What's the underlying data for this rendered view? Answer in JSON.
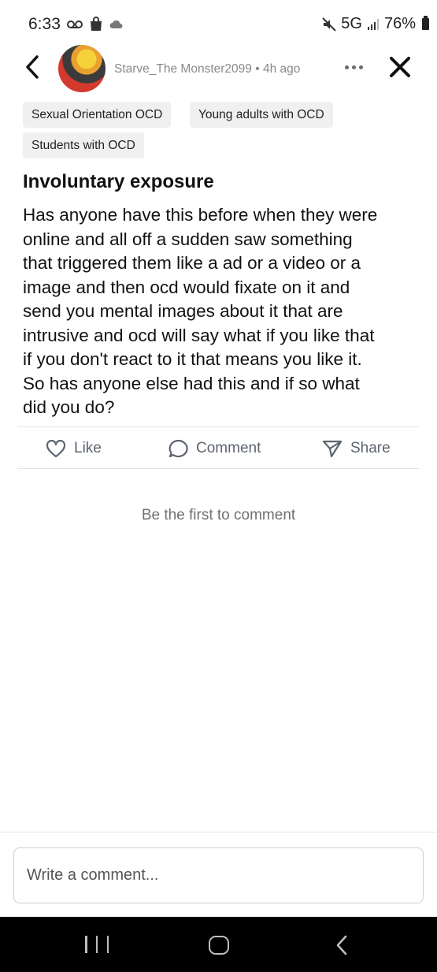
{
  "status_bar": {
    "time": "6:33",
    "network": "5G",
    "battery": "76%"
  },
  "header": {
    "author": "Starve_The Monster2099",
    "separator": "•",
    "time_ago": "4h ago"
  },
  "tags": [
    "Sexual Orientation OCD",
    "Young adults with OCD",
    "Students with OCD"
  ],
  "post": {
    "title": "Involuntary exposure",
    "body_lines": [
      "Has anyone have this before when they were",
      "online and all off a sudden saw something",
      "that triggered them like a ad or a video or a",
      "image and then ocd would fixate on it and",
      "send you mental images about it that are",
      "intrusive and ocd will say what if you like that",
      "if you don't react to it that means you like it.",
      "So has anyone else had this and if so what",
      "did you do?"
    ]
  },
  "actions": {
    "like": "Like",
    "comment": "Comment",
    "share": "Share"
  },
  "comments": {
    "empty_text": "Be the first to comment"
  },
  "composer": {
    "placeholder": "Write a comment..."
  },
  "colors": {
    "tag_bg": "#f0f0f0",
    "action_text": "#5d6470",
    "muted_text": "#8a8a8a",
    "nav_bar_bg": "#000000"
  },
  "icons": {
    "back": "chevron-left-icon",
    "more": "more-horizontal-icon",
    "close": "close-icon",
    "like": "heart-icon",
    "comment": "speech-bubble-icon",
    "share": "send-icon"
  }
}
